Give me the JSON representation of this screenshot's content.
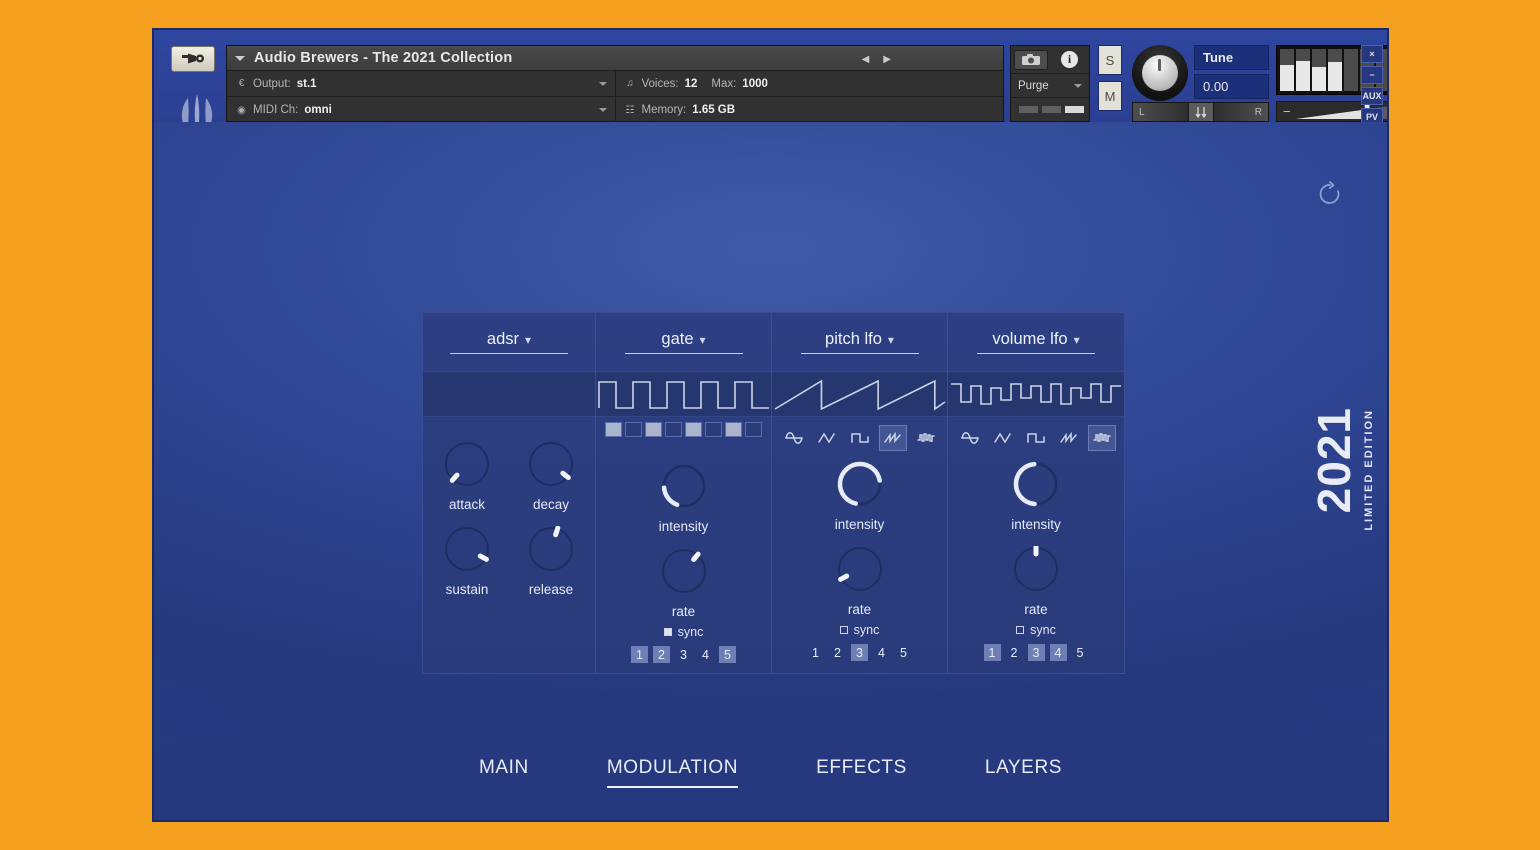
{
  "window": {
    "wrench_icon": "wrench-icon",
    "logo_icon": "brand-leaf-logo",
    "rack_bars_icon": "rack-handle-icon"
  },
  "header": {
    "instrument_name": "Audio Brewers - The 2021 Collection",
    "output": {
      "label": "Output:",
      "value": "st.1",
      "icon": "output-routing-icon"
    },
    "midi": {
      "label": "MIDI Ch:",
      "value": "omni",
      "icon": "midi-icon"
    },
    "voices": {
      "label": "Voices:",
      "value": "12",
      "max_label": "Max:",
      "max_value": "1000",
      "icon": "voices-icon"
    },
    "memory": {
      "label": "Memory:",
      "value": "1.65 GB",
      "icon": "memory-icon"
    },
    "nav": {
      "prev_icon": "prev-arrow-icon",
      "next_icon": "next-arrow-icon"
    },
    "snapshot_icon": "camera-icon",
    "info_icon": "info-icon",
    "purge": {
      "label": "Purge",
      "chevron_icon": "chevron-down-icon"
    },
    "solo_label": "S",
    "mute_label": "M",
    "tune": {
      "label": "Tune",
      "value": "0.00",
      "knob_icon": "tune-knob"
    },
    "pan": {
      "left_label": "L",
      "right_label": "R",
      "center_icon": "pan-center-icon"
    },
    "volume": {
      "minus_label": "−",
      "plus_label": "+"
    },
    "window_buttons": [
      {
        "label": "×",
        "name": "close-button"
      },
      {
        "label": "−",
        "name": "minimize-button"
      },
      {
        "label": "AUX",
        "name": "aux-button"
      },
      {
        "label": "PV",
        "name": "pv-button"
      }
    ],
    "meter_levels": [
      62,
      72,
      58,
      70,
      0,
      0,
      0,
      0
    ]
  },
  "body": {
    "reset_icon": "reset-circular-arrow-icon",
    "edition_year": "2021",
    "edition_subtitle": "LIMITED EDITION"
  },
  "modulation": {
    "panels": [
      {
        "title": "adsr",
        "chevron_icon": "chevron-down-icon",
        "type": "adsr",
        "waveform": "none",
        "knobs": [
          {
            "label": "attack",
            "angle": -138
          },
          {
            "label": "decay",
            "angle": 128
          },
          {
            "label": "sustain",
            "angle": 118
          },
          {
            "label": "release",
            "angle": 18
          }
        ]
      },
      {
        "title": "gate",
        "chevron_icon": "chevron-down-icon",
        "type": "gate",
        "waveform": "square",
        "steps": [
          true,
          false,
          true,
          false,
          true,
          false,
          true,
          false
        ],
        "intensity": {
          "label": "intensity",
          "arc_start": -160,
          "arc_end": -95
        },
        "rate": {
          "label": "rate",
          "angle": 40
        },
        "sync": {
          "label": "sync",
          "checked": true
        },
        "numbers": [
          {
            "label": "1",
            "on": true
          },
          {
            "label": "2",
            "on": true
          },
          {
            "label": "3",
            "on": false
          },
          {
            "label": "4",
            "on": false
          },
          {
            "label": "5",
            "on": true
          }
        ]
      },
      {
        "title": "pitch lfo",
        "chevron_icon": "chevron-down-icon",
        "type": "lfo",
        "waveform": "saw",
        "wave_options": [
          "sine",
          "triangle",
          "square",
          "saw",
          "random"
        ],
        "wave_selected": 3,
        "intensity": {
          "label": "intensity",
          "arc_start": -168,
          "arc_end": 80
        },
        "rate": {
          "label": "rate",
          "angle": -118
        },
        "sync": {
          "label": "sync",
          "checked": false
        },
        "numbers": [
          {
            "label": "1",
            "on": false
          },
          {
            "label": "2",
            "on": false
          },
          {
            "label": "3",
            "on": true
          },
          {
            "label": "4",
            "on": false
          },
          {
            "label": "5",
            "on": false
          }
        ]
      },
      {
        "title": "volume lfo",
        "chevron_icon": "chevron-down-icon",
        "type": "lfo",
        "waveform": "random",
        "wave_options": [
          "sine",
          "triangle",
          "square",
          "saw",
          "random"
        ],
        "wave_selected": 4,
        "intensity": {
          "label": "intensity",
          "arc_start": -176,
          "arc_end": -5
        },
        "rate": {
          "label": "rate",
          "angle": 0
        },
        "sync": {
          "label": "sync",
          "checked": false
        },
        "numbers": [
          {
            "label": "1",
            "on": true
          },
          {
            "label": "2",
            "on": false
          },
          {
            "label": "3",
            "on": true
          },
          {
            "label": "4",
            "on": true
          },
          {
            "label": "5",
            "on": false
          }
        ]
      }
    ]
  },
  "tabs": [
    {
      "label": "MAIN",
      "active": false
    },
    {
      "label": "MODULATION",
      "active": true
    },
    {
      "label": "EFFECTS",
      "active": false
    },
    {
      "label": "LAYERS",
      "active": false
    }
  ],
  "colors": {
    "page_background": "#f5a01e",
    "panel_blue": "#2c3e8f",
    "accent_text": "#eef1fa",
    "wave_stroke": "#ccd4e8",
    "knob_indicator": "#ffffff"
  }
}
